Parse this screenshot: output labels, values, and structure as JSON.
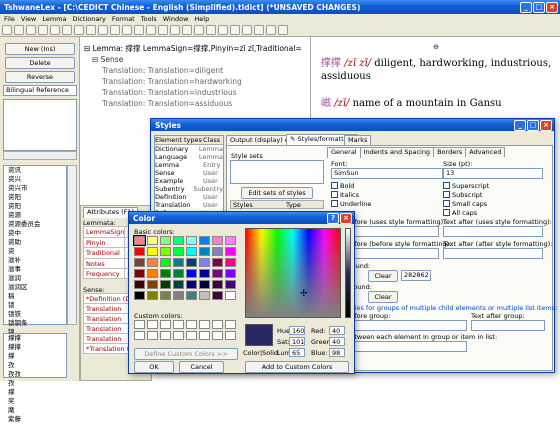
{
  "app": {
    "title": "TshwaneLex - [C:\\CEDICT Chinese - English (Simplified).tldict] (*UNSAVED CHANGES)",
    "menu": [
      "File",
      "View",
      "Lemma",
      "Dictionary",
      "Format",
      "Tools",
      "Window",
      "Help"
    ]
  },
  "left": {
    "buttons": {
      "new": "New (Ins)",
      "delete": "Delete",
      "reverse": "Reverse"
    },
    "biling": "Bilingual Reference",
    "list1": [
      "资讯",
      "资兴",
      "资兴市",
      "资阳",
      "资阳",
      "资源",
      "资源委员会",
      "资中",
      "资助",
      "资",
      "滋补",
      "滋事",
      "滋润",
      "滋润区",
      "稿",
      "锁",
      "锁铁",
      "锁钢条",
      "锦",
      "整理"
    ],
    "selected": "撑撑",
    "list2": [
      "撑撑",
      "撑撑",
      "撑",
      "孜",
      "孜孜",
      "孜",
      "撑",
      "奖",
      "麾",
      "紫藤"
    ]
  },
  "tree": {
    "lemma": "Lemma: 撑撑 LemmaSign=撑撑,Pinyin=zī zī,Traditional=",
    "sense": "Sense",
    "translations": [
      "Translation: Translation=diligent",
      "Translation: Translation=hardworking",
      "Translation: Translation=industrious",
      "Translation: Translation=assiduous"
    ]
  },
  "preview": {
    "entry1_hz": "撑撑",
    "entry1_py": "/zī zī/",
    "entry1_def": "diligent, hardworking, industrious, assiduous",
    "entry2_hz": "嵫",
    "entry2_py": "/zī/",
    "entry2_def": "name of a mountain in Gansu"
  },
  "attrs": {
    "tab": "Attributes (F1)",
    "lemmata": "Lemmata:",
    "rows": [
      [
        "LemmaSign",
        "撑撑"
      ],
      [
        "Pinyin",
        "zī zī"
      ],
      [
        "Traditional",
        "撑撑"
      ],
      [
        "Notes",
        ""
      ],
      [
        "Frequency",
        "0"
      ]
    ],
    "sense": "Sense:",
    "srows": [
      [
        "*Definition (Default)",
        ""
      ],
      [
        "Translation",
        "diligent"
      ],
      [
        "Translation",
        "hard"
      ],
      [
        "Translation",
        "indu"
      ],
      [
        "Translation",
        "assi"
      ],
      [
        "*Translation (Default)",
        ""
      ]
    ]
  },
  "styles": {
    "title": "Styles",
    "tabs": [
      "Element types",
      "Class"
    ],
    "output_tab": "Output (display) order",
    "styles_tab": "Styles/formatting",
    "marks_tab": "Marks",
    "types": [
      [
        "Dictionary",
        "Lemma"
      ],
      [
        "Language",
        "Lemma"
      ],
      [
        "Lemma",
        "Entry"
      ],
      [
        "Sense",
        "User"
      ],
      [
        "Example",
        "User"
      ],
      [
        "Subentry",
        "Subentry"
      ],
      [
        "Definition",
        "User"
      ],
      [
        "Translation",
        "User"
      ],
      [
        "References",
        "User"
      ]
    ],
    "style_sets": "Style sets",
    "edit_sets": "Edit sets of styles",
    "cols": [
      "Styles",
      "Type"
    ],
    "inner_tabs": [
      "General",
      "Indents and Spacing",
      "Borders",
      "Advanced"
    ],
    "font_label": "Font:",
    "font": "SimSun",
    "size_label": "Size (pt):",
    "size": "13",
    "bold": "Bold",
    "italics": "Italics",
    "underline": "Underline",
    "superscript": "Superscript",
    "subscript": "Subscript",
    "smallcaps": "Small caps",
    "allcaps": "All caps",
    "text_before": "Text before (uses style formatting):",
    "text_after": "Text after (uses style formatting):",
    "text_before2": "Text before (before style formatting):",
    "text_after2": "Text after (after style formatting):",
    "foreground": "Foreground:",
    "clear": "Clear",
    "fg_hex": "282862",
    "background": "Background:",
    "groups": "Properties for groups of multiple child elements or multiple list items:",
    "before_group": "Text before group:",
    "after_group": "Text after group:",
    "between": "Text between each element in group or item in list:"
  },
  "color": {
    "title": "Color",
    "help": "?",
    "basic": "Basic colors:",
    "custom": "Custom colors:",
    "define": "Define Custom Colors >>",
    "ok": "OK",
    "cancel": "Cancel",
    "add": "Add to Custom Colors",
    "colorsolid": "Color|Solid",
    "hue_l": "Hue:",
    "hue": "160",
    "sat_l": "Sat:",
    "sat": "101",
    "lum_l": "Lum:",
    "lum": "65",
    "red_l": "Red:",
    "red": "40",
    "green_l": "Green:",
    "green": "40",
    "blue_l": "Blue:",
    "blue": "98",
    "basic_colors": [
      "#ff8080",
      "#ffff80",
      "#80ff80",
      "#00ff80",
      "#80ffff",
      "#0080ff",
      "#ff80c0",
      "#ff80ff",
      "#ff0000",
      "#ffff00",
      "#80ff00",
      "#00ff40",
      "#00ffff",
      "#0080c0",
      "#8080c0",
      "#ff00ff",
      "#804040",
      "#ff8040",
      "#00ff00",
      "#008080",
      "#004080",
      "#8080ff",
      "#800040",
      "#ff0080",
      "#800000",
      "#ff8000",
      "#008000",
      "#008040",
      "#0000ff",
      "#0000a0",
      "#800080",
      "#8000ff",
      "#400000",
      "#804000",
      "#004000",
      "#004040",
      "#000080",
      "#000040",
      "#400040",
      "#400080",
      "#000000",
      "#808000",
      "#808040",
      "#808080",
      "#408080",
      "#c0c0c0",
      "#400040",
      "#ffffff"
    ],
    "selected_color": "#282862"
  }
}
